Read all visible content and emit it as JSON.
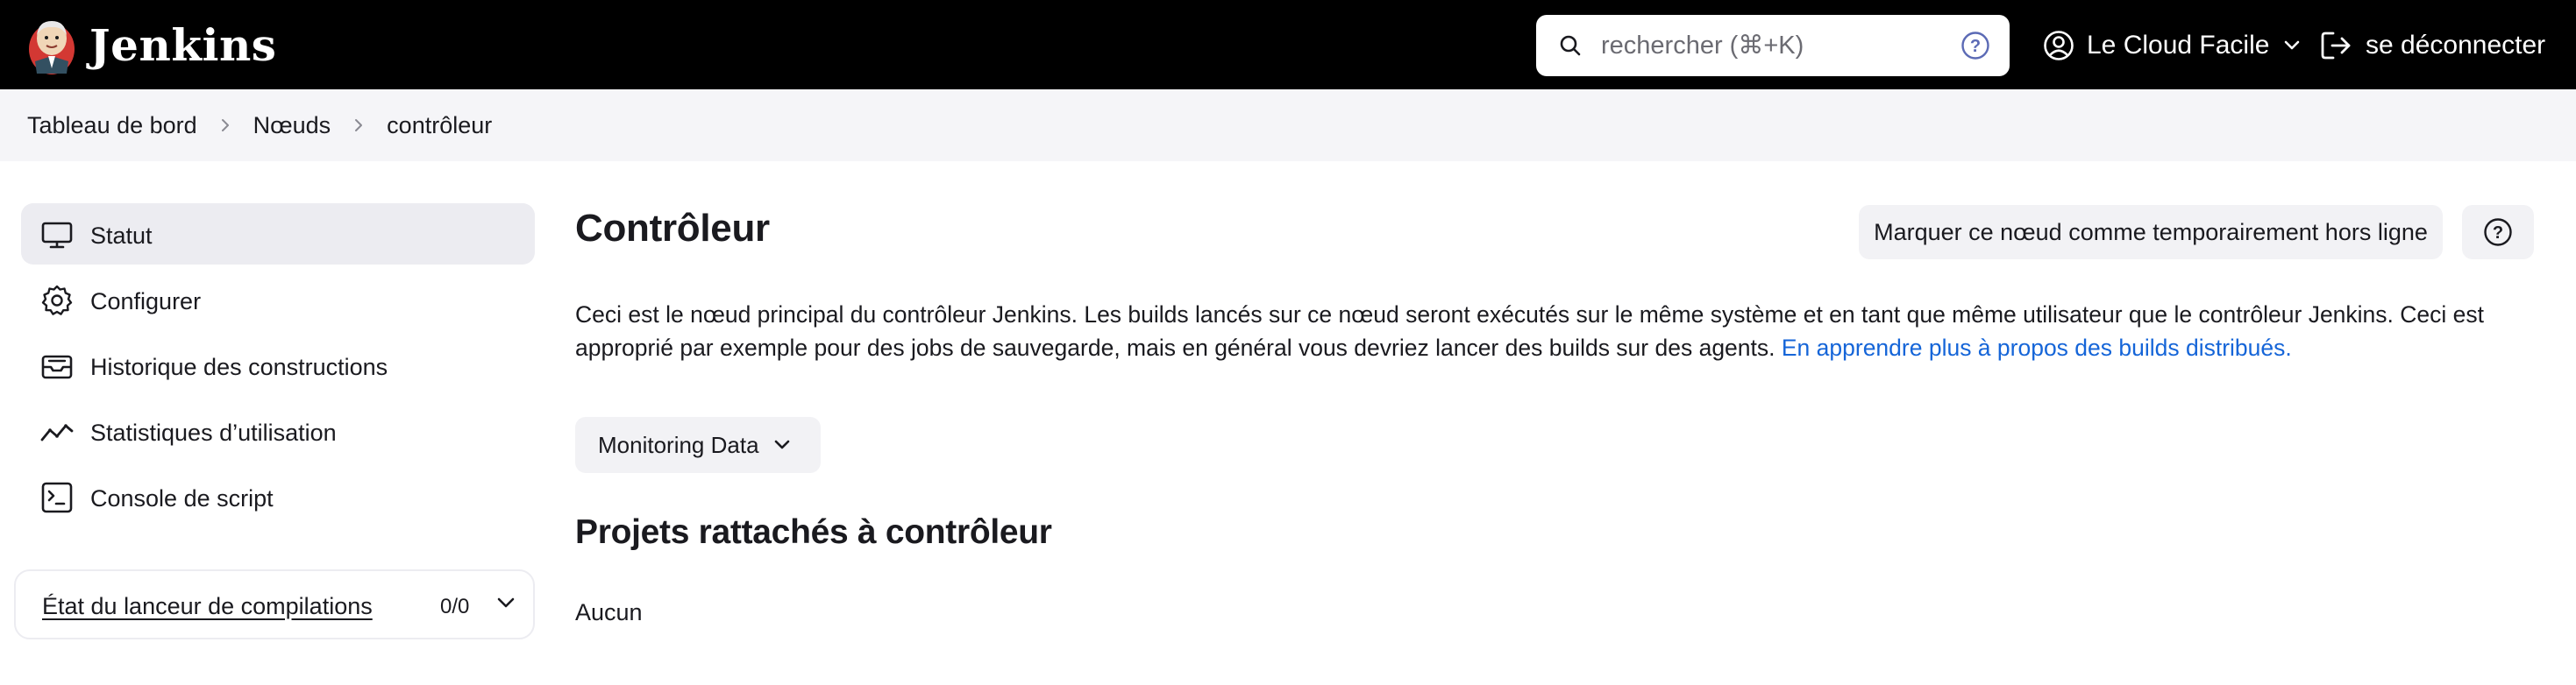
{
  "header": {
    "brand": "Jenkins",
    "search_placeholder": "rechercher (⌘+K)",
    "user_name": "Le Cloud Facile",
    "logout_label": "se déconnecter"
  },
  "breadcrumb": [
    "Tableau de bord",
    "Nœuds",
    "contrôleur"
  ],
  "sidebar": {
    "items": [
      {
        "label": "Statut",
        "icon": "computer-icon",
        "active": true
      },
      {
        "label": "Configurer",
        "icon": "gear-icon"
      },
      {
        "label": "Historique des constructions",
        "icon": "inbox-icon"
      },
      {
        "label": "Statistiques d’utilisation",
        "icon": "trend-chart-icon"
      },
      {
        "label": "Console de script",
        "icon": "terminal-icon"
      }
    ],
    "executors": {
      "title": "État du lanceur de compilations",
      "count": "0/0"
    }
  },
  "main": {
    "title": "Contrôleur",
    "offline_button": "Marquer ce nœud comme temporairement hors ligne",
    "description": "Ceci est le nœud principal du contrôleur Jenkins. Les builds lancés sur ce nœud seront exécutés sur le même système et en tant que même utilisateur que le contrôleur Jenkins. Ceci est approprié par exemple pour des jobs de sauvegarde, mais en général vous devriez lancer des builds sur des agents. ",
    "description_link": "En apprendre plus à propos des builds distribués.",
    "monitoring_button": "Monitoring Data",
    "projects_title": "Projets rattachés à contrôleur",
    "projects_empty": "Aucun"
  },
  "colors": {
    "header_bg": "#000000",
    "breadcrumb_bg": "#f5f5f8",
    "active_item_bg": "#ececf1",
    "button_bg": "#f2f2f5",
    "link": "#1565d8"
  }
}
